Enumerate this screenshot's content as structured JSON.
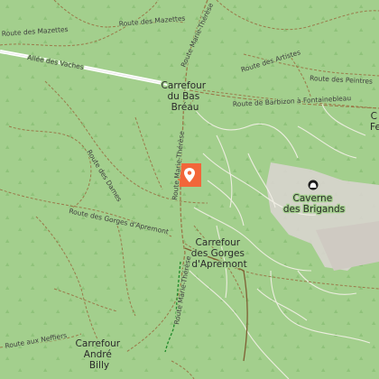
{
  "map": {
    "colors": {
      "forest": "#a3cf8d",
      "rock": "#d8d4ce",
      "track": "#9a7a4a",
      "path": "#f4f1e8",
      "main_road": "#ffffff",
      "marker": "#f2663a",
      "greenpath": "#1f8a2a"
    },
    "places": {
      "bas_breau": [
        "Carrefour",
        "du Bas",
        "Bréau"
      ],
      "gorges": [
        "Carrefour",
        "des Gorges",
        "d'Apremont"
      ],
      "andre_billy": [
        "Carrefour",
        "André",
        "Billy"
      ],
      "caverne": [
        "Caverne",
        "des Brigands"
      ],
      "edge_right": [
        "C",
        "Fe"
      ]
    },
    "roads": {
      "mazettes_1": "Route des Mazettes",
      "mazettes_2": "Route des Mazettes",
      "vaches": "Allée des Vaches",
      "marie_therese_n": "Route Marie-Thérèse",
      "marie_therese_mid": "Route Marie-Thérèse",
      "marie_therese_s": "Route Marie-Thérèse",
      "artistes": "Route des Artistes",
      "peintres": "Route des Peintres",
      "barbizon": "Route de Barbizon à Fontainebleau",
      "dames": "Route des Dames",
      "gorges_apremont": "Route des Gorges d'Apremont",
      "neffiers": "Route aux Neffiers"
    },
    "icons": {
      "marker": "map-pin-icon",
      "cave": "cave-icon"
    }
  }
}
